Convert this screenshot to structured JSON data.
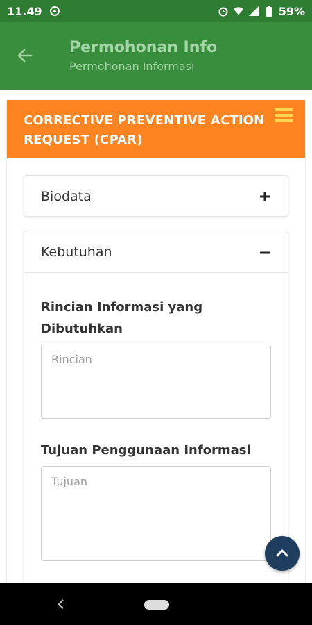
{
  "status_bar": {
    "time": "11.49",
    "battery": "59%",
    "icons": [
      "data-saver-icon",
      "alarm-icon",
      "wifi-icon",
      "signal-icon",
      "battery-icon"
    ]
  },
  "app_bar": {
    "title": "Permohonan Info",
    "subtitle": "Permohonan Informasi",
    "back_icon": "arrow-left-icon"
  },
  "card": {
    "title": "CORRECTIVE PREVENTIVE ACTION REQUEST (CPAR)",
    "menu_icon": "hamburger-icon"
  },
  "panels": [
    {
      "label": "Biodata",
      "state": "collapsed",
      "toggle_icon": "plus-icon"
    },
    {
      "label": "Kebutuhan",
      "state": "expanded",
      "toggle_icon": "minus-icon"
    }
  ],
  "form": {
    "rincian": {
      "label": "Rincian Informasi yang Dibutuhkan",
      "placeholder": "Rincian",
      "value": ""
    },
    "tujuan": {
      "label": "Tujuan Penggunaan Informasi",
      "placeholder": "Tujuan",
      "value": ""
    }
  },
  "fab": {
    "icon": "chevron-up-icon"
  },
  "nav_bar": {
    "back_icon": "nav-back-icon",
    "home_icon": "home-pill-icon"
  },
  "colors": {
    "status_bar": "#2e7d32",
    "app_bar": "#388e3c",
    "title_text": "#a5d6a7",
    "card_header": "#fd8421",
    "hamburger": "#ffd54f",
    "fab": "#1f3d5f"
  }
}
